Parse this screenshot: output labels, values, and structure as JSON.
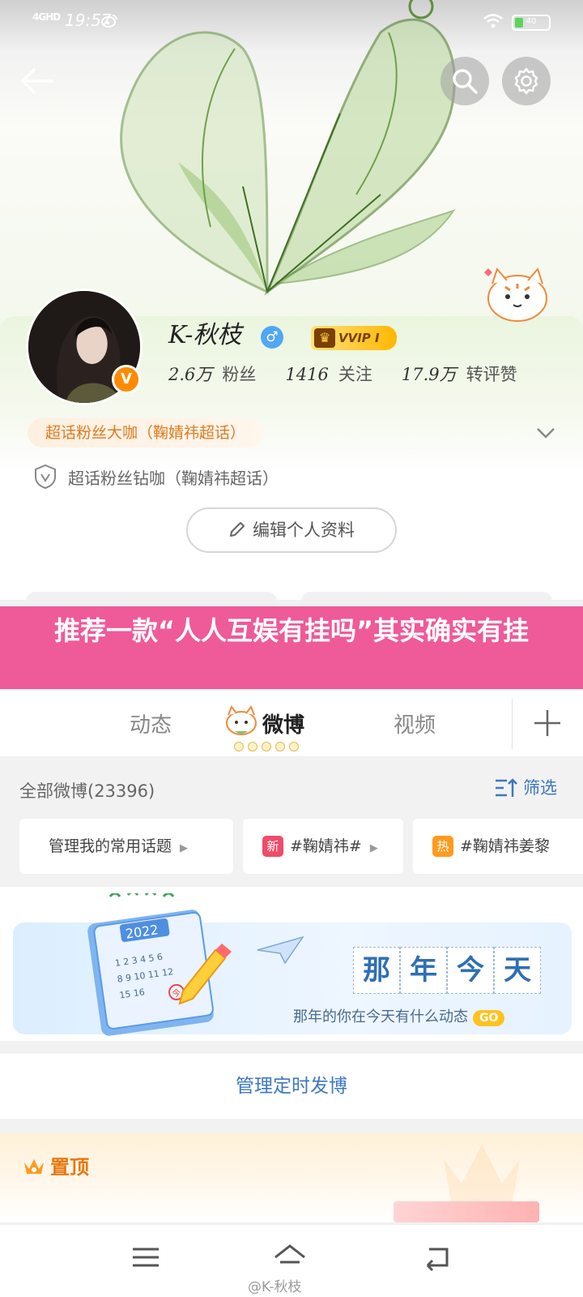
{
  "status_bar": {
    "network": "4GHD",
    "time": "19:57",
    "battery": "40"
  },
  "profile": {
    "username": "K-秋枝",
    "gender_symbol": "♂",
    "membership_badge": "VVIP I",
    "verified_badge": "V",
    "stats": [
      {
        "value": "2.6万",
        "label": "粉丝"
      },
      {
        "value": "1416",
        "label": "关注"
      },
      {
        "value": "17.9万",
        "label": "转评赞"
      }
    ],
    "title_tag": "超话粉丝大咖（鞠婧祎超话）",
    "super_fan_line": "超话粉丝钻咖（鞠婧祎超话）",
    "edit_profile_label": "编辑个人资料"
  },
  "promo_overlay": "推荐一款“人人互娱有挂吗”其实确实有挂",
  "tabs": {
    "items": [
      "动态",
      "微博",
      "视频"
    ],
    "active": "微博"
  },
  "feed_filter": {
    "all_count_label": "全部微博(23396)",
    "filter_label": "筛选",
    "chips": [
      {
        "tag": "",
        "text": "管理我的常用话题"
      },
      {
        "tag": "新",
        "tag_color": "#f04b6a",
        "text": "#鞠婧祎#"
      },
      {
        "tag": "热",
        "tag_color": "#ff9a1f",
        "text": "#鞠婧祎姜黎"
      }
    ]
  },
  "memory_banner": {
    "title_chars": [
      "那",
      "年",
      "今",
      "天"
    ],
    "subtitle": "那年的你在今天有什么动态",
    "go_label": "GO",
    "calendar_year": "2022",
    "calendar_today": "今"
  },
  "schedule_label": "管理定时发博",
  "pinned_label": "置顶",
  "watermark": "@K-秋枝",
  "colors": {
    "accent_blue": "#3c78c2",
    "promo_pink": "#ef5a98",
    "orange": "#ff8a00",
    "vvip_gold": "#ffb700"
  }
}
